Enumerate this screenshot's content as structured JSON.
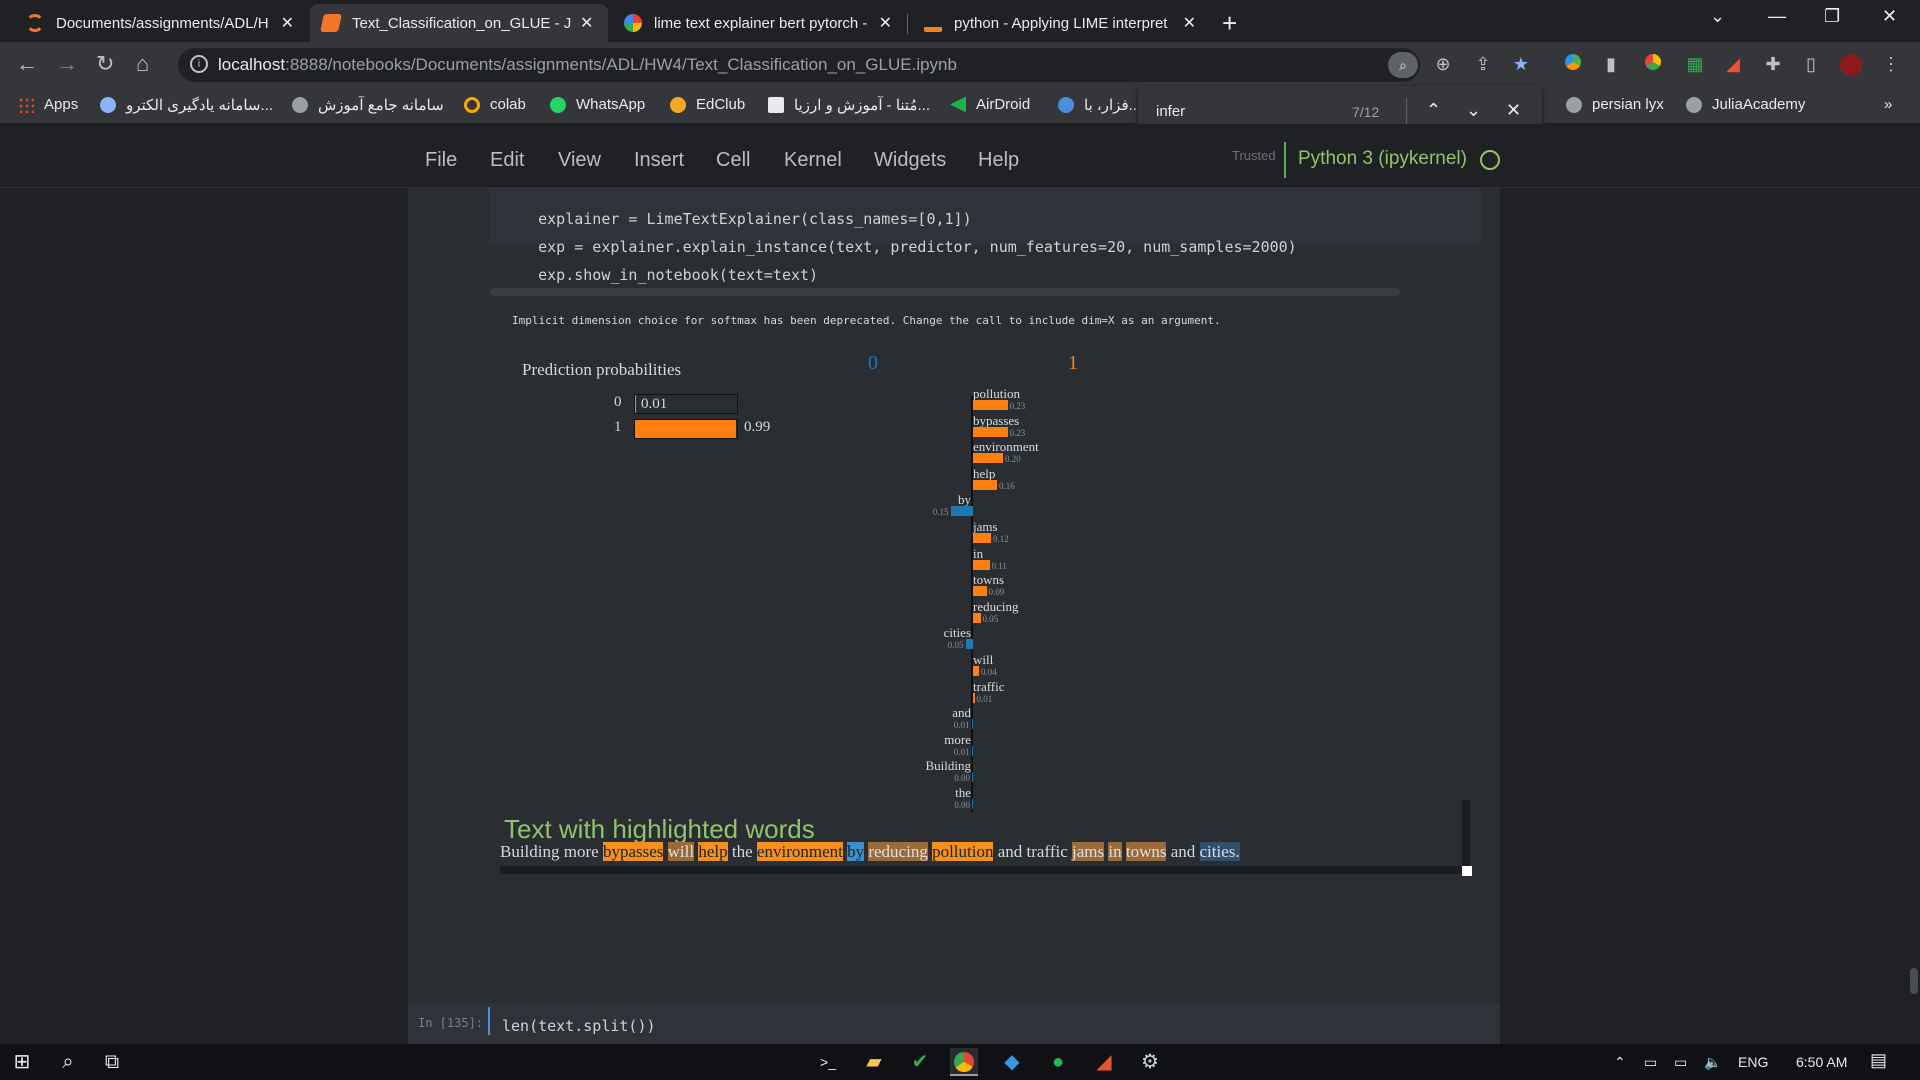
{
  "browser": {
    "tabs": [
      {
        "title": "Documents/assignments/ADL/H",
        "active": false
      },
      {
        "title": "Text_Classification_on_GLUE - Jup",
        "active": true
      },
      {
        "title": "lime text explainer bert pytorch -",
        "active": false
      },
      {
        "title": "python - Applying LIME interpret",
        "active": false
      }
    ],
    "url_host": "localhost",
    "url_path": ":8888/notebooks/Documents/assignments/ADL/HW4/Text_Classification_on_GLUE.ipynb",
    "bookmarks": [
      {
        "label": "Apps"
      },
      {
        "label": "سامانه یادگیری الکترو..."
      },
      {
        "label": "سامانه جامع آموزش"
      },
      {
        "label": "colab"
      },
      {
        "label": "WhatsApp"
      },
      {
        "label": "EdClub"
      },
      {
        "label": "مُتنا - آموزش و ارزیا..."
      },
      {
        "label": "AirDroid"
      },
      {
        "label": "فزار، با..."
      },
      {
        "label": "persian lyx"
      },
      {
        "label": "JuliaAcademy"
      }
    ],
    "find": {
      "query": "infer",
      "count": "7/12"
    }
  },
  "jupyter": {
    "menu": [
      "File",
      "Edit",
      "View",
      "Insert",
      "Cell",
      "Kernel",
      "Widgets",
      "Help"
    ],
    "trusted": "Trusted",
    "kernel": "Python 3 (ipykernel)"
  },
  "code": {
    "line1": "explainer = LimeTextExplainer(class_names=[0,1])",
    "line2": "exp = explainer.explain_instance(text, predictor, num_features=20, num_samples=2000)",
    "line3": "exp.show_in_notebook(text=text)"
  },
  "output": {
    "warning": "Implicit dimension choice for softmax has been deprecated. Change the call to include dim=X as an argument.",
    "pred_title": "Prediction probabilities",
    "pred": [
      {
        "label": "0",
        "value": "0.01",
        "fraction": 0.01
      },
      {
        "label": "1",
        "value": "0.99",
        "fraction": 0.99
      }
    ],
    "class0": "0",
    "class1": "1",
    "features": [
      {
        "word": "pollution",
        "value": "0.23",
        "weight": 0.23
      },
      {
        "word": "bypasses",
        "value": "0.23",
        "weight": 0.23
      },
      {
        "word": "environment",
        "value": "0.20",
        "weight": 0.2
      },
      {
        "word": "help",
        "value": "0.16",
        "weight": 0.16
      },
      {
        "word": "by",
        "value": "0.15",
        "weight": -0.15
      },
      {
        "word": "jams",
        "value": "0.12",
        "weight": 0.12
      },
      {
        "word": "in",
        "value": "0.11",
        "weight": 0.11
      },
      {
        "word": "towns",
        "value": "0.09",
        "weight": 0.09
      },
      {
        "word": "reducing",
        "value": "0.05",
        "weight": 0.05
      },
      {
        "word": "cities",
        "value": "0.05",
        "weight": -0.05
      },
      {
        "word": "will",
        "value": "0.04",
        "weight": 0.04
      },
      {
        "word": "traffic",
        "value": "0.01",
        "weight": 0.01
      },
      {
        "word": "and",
        "value": "0.01",
        "weight": -0.01
      },
      {
        "word": "more",
        "value": "0.01",
        "weight": -0.01
      },
      {
        "word": "Building",
        "value": "0.00",
        "weight": -0.001
      },
      {
        "word": "the",
        "value": "0.00",
        "weight": -0.001
      }
    ],
    "hl_title": "Text with highlighted words",
    "hl_words": [
      {
        "w": "Building",
        "c": ""
      },
      {
        "w": "more",
        "c": ""
      },
      {
        "w": "bypasses",
        "c": "o"
      },
      {
        "w": "will",
        "c": "ol"
      },
      {
        "w": "help",
        "c": "o"
      },
      {
        "w": "the",
        "c": ""
      },
      {
        "w": "environment",
        "c": "o"
      },
      {
        "w": "by",
        "c": "b"
      },
      {
        "w": "reducing",
        "c": "ol"
      },
      {
        "w": "pollution",
        "c": "o"
      },
      {
        "w": "and",
        "c": ""
      },
      {
        "w": "traffic",
        "c": ""
      },
      {
        "w": "jams",
        "c": "ol"
      },
      {
        "w": "in",
        "c": "ol"
      },
      {
        "w": "towns",
        "c": "ol"
      },
      {
        "w": "and",
        "c": ""
      },
      {
        "w": "cities.",
        "c": "bl"
      }
    ]
  },
  "next_cell": {
    "prompt": "In [135]:",
    "code": "len(text.split())"
  },
  "taskbar": {
    "lang": "ENG",
    "time": "6:50 AM"
  },
  "colors": {
    "positive": "#ff7f0e",
    "negative": "#1f77b4",
    "class0": "#1f77b4",
    "class1": "#ff7f0e"
  }
}
